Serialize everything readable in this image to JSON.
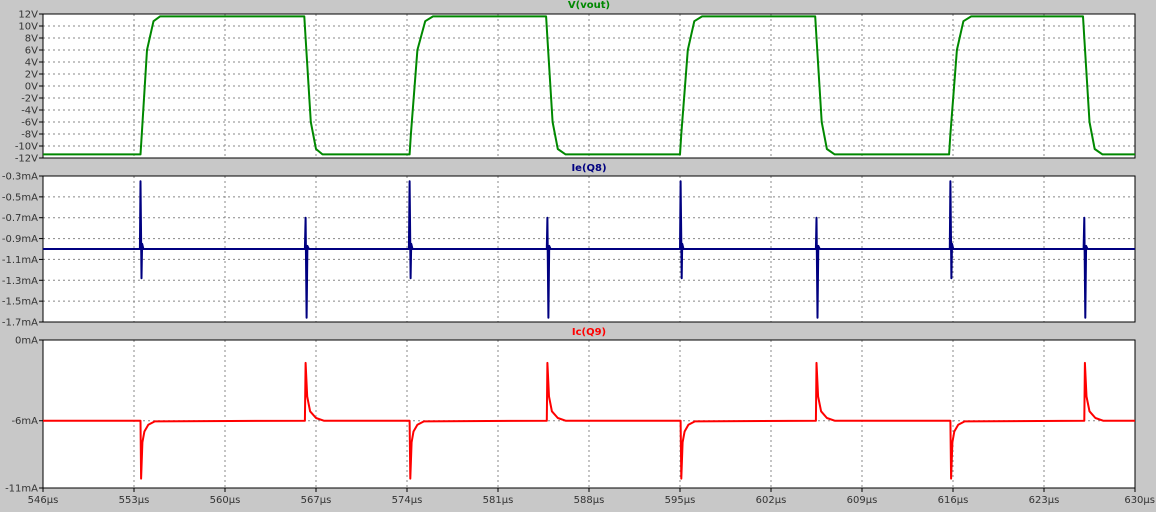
{
  "window": {
    "background": "#C8C8C8",
    "plot_background": "#FFFFFF",
    "grid_color": "#888888",
    "frame_color": "#000000"
  },
  "chart_data": [
    {
      "type": "line",
      "title": "V(vout)",
      "color": "#008800",
      "x_unit": "µs",
      "xlim": [
        546,
        630
      ],
      "x_ticks": [
        546,
        553,
        560,
        567,
        574,
        581,
        588,
        595,
        602,
        609,
        616,
        623,
        630
      ],
      "x_tick_labels": [
        "546µs",
        "553µs",
        "560µs",
        "567µs",
        "574µs",
        "581µs",
        "588µs",
        "595µs",
        "602µs",
        "609µs",
        "616µs",
        "623µs",
        "630µs"
      ],
      "ylim": [
        -12,
        12
      ],
      "y_ticks": [
        12,
        10,
        8,
        6,
        4,
        2,
        0,
        -2,
        -4,
        -6,
        -8,
        -10,
        -12
      ],
      "y_tick_labels": [
        "12V",
        "10V",
        "8V",
        "6V",
        "4V",
        "2V",
        "0V",
        "-2V",
        "-4V",
        "-6V",
        "-8V",
        "-10V",
        "-12V"
      ],
      "grid": true,
      "series": [
        {
          "name": "V(vout)",
          "x": [
            546,
            553.5,
            553.6,
            554,
            554.5,
            555,
            566.1,
            566.2,
            566.6,
            567,
            567.5,
            574.2,
            574.3,
            574.8,
            575.4,
            576,
            584.7,
            584.8,
            585.2,
            585.6,
            586.2,
            595.0,
            595.1,
            595.6,
            596.1,
            596.7,
            605.4,
            605.5,
            605.9,
            606.3,
            606.9,
            615.7,
            615.8,
            616.3,
            616.8,
            617.4,
            626.0,
            626.1,
            626.5,
            626.9,
            627.5,
            630
          ],
          "y": [
            -11.4,
            -11.4,
            -8,
            6,
            10.8,
            11.6,
            11.6,
            8,
            -6,
            -10.5,
            -11.4,
            -11.4,
            -8,
            6,
            10.8,
            11.6,
            11.6,
            8,
            -6,
            -10.5,
            -11.4,
            -11.4,
            -8,
            6,
            10.8,
            11.6,
            11.6,
            8,
            -6,
            -10.5,
            -11.4,
            -11.4,
            -8,
            6,
            10.8,
            11.6,
            11.6,
            8,
            -6,
            -10.5,
            -11.4,
            -11.4
          ]
        }
      ]
    },
    {
      "type": "line",
      "title": "Ie(Q8)",
      "color": "#000080",
      "x_unit": "µs",
      "xlim": [
        546,
        630
      ],
      "x_ticks": [
        546,
        553,
        560,
        567,
        574,
        581,
        588,
        595,
        602,
        609,
        616,
        623,
        630
      ],
      "ylim": [
        -1.7,
        -0.3
      ],
      "y_ticks": [
        -0.3,
        -0.5,
        -0.7,
        -0.9,
        -1.1,
        -1.3,
        -1.5,
        -1.7
      ],
      "y_tick_labels": [
        "-0.3mA",
        "-0.5mA",
        "-0.7mA",
        "-0.9mA",
        "-1.1mA",
        "-1.3mA",
        "-1.5mA",
        "-1.7mA"
      ],
      "grid": true,
      "series": [
        {
          "name": "Ie(Q8)",
          "x": [
            546,
            553.45,
            553.5,
            553.58,
            553.62,
            553.72,
            554.0,
            566.15,
            566.2,
            566.28,
            566.34,
            566.45,
            567.0,
            574.15,
            574.2,
            574.28,
            574.32,
            574.42,
            574.7,
            584.75,
            584.8,
            584.88,
            584.94,
            585.05,
            585.6,
            595.0,
            595.05,
            595.13,
            595.17,
            595.27,
            595.55,
            605.45,
            605.5,
            605.58,
            605.64,
            605.75,
            606.3,
            615.75,
            615.8,
            615.88,
            615.92,
            616.02,
            616.3,
            626.05,
            626.1,
            626.18,
            626.24,
            626.35,
            626.9,
            630
          ],
          "y": [
            -1.0,
            -1.0,
            -0.35,
            -1.28,
            -0.95,
            -1.0,
            -1.0,
            -1.0,
            -0.7,
            -1.66,
            -0.97,
            -1.0,
            -1.0,
            -1.0,
            -0.35,
            -1.28,
            -0.95,
            -1.0,
            -1.0,
            -1.0,
            -0.7,
            -1.66,
            -0.97,
            -1.0,
            -1.0,
            -1.0,
            -0.35,
            -1.28,
            -0.95,
            -1.0,
            -1.0,
            -1.0,
            -0.7,
            -1.66,
            -0.97,
            -1.0,
            -1.0,
            -1.0,
            -0.35,
            -1.28,
            -0.95,
            -1.0,
            -1.0,
            -1.0,
            -0.7,
            -1.66,
            -0.97,
            -1.0,
            -1.0,
            -1.0
          ]
        }
      ]
    },
    {
      "type": "line",
      "title": "Ic(Q9)",
      "color": "#FF0000",
      "x_unit": "µs",
      "xlim": [
        546,
        630
      ],
      "x_ticks": [
        546,
        553,
        560,
        567,
        574,
        581,
        588,
        595,
        602,
        609,
        616,
        623,
        630
      ],
      "x_tick_labels": [
        "546µs",
        "553µs",
        "560µs",
        "567µs",
        "574µs",
        "581µs",
        "588µs",
        "595µs",
        "602µs",
        "609µs",
        "616µs",
        "623µs",
        "630µs"
      ],
      "ylim": [
        -11,
        0
      ],
      "y_ticks": [
        0,
        -6,
        -11
      ],
      "y_tick_labels": [
        "0mA",
        "-6mA",
        "-11mA"
      ],
      "grid": true,
      "series": [
        {
          "name": "Ic(Q9)",
          "x": [
            546,
            553.5,
            553.55,
            553.65,
            553.8,
            554.1,
            554.6,
            566.15,
            566.2,
            566.32,
            566.55,
            567.0,
            567.6,
            574.2,
            574.25,
            574.35,
            574.5,
            574.8,
            575.3,
            584.75,
            584.8,
            584.92,
            585.15,
            585.6,
            586.2,
            595.05,
            595.1,
            595.2,
            595.35,
            595.65,
            596.15,
            605.45,
            605.5,
            605.62,
            605.85,
            606.3,
            606.9,
            615.8,
            615.85,
            615.95,
            616.1,
            616.4,
            616.9,
            626.1,
            626.15,
            626.27,
            626.5,
            626.95,
            627.55,
            630
          ],
          "y": [
            -6.0,
            -6.0,
            -10.3,
            -7.6,
            -6.8,
            -6.3,
            -6.05,
            -6.0,
            -1.7,
            -4.2,
            -5.3,
            -5.8,
            -6.0,
            -6.0,
            -10.3,
            -7.6,
            -6.8,
            -6.3,
            -6.05,
            -6.0,
            -1.7,
            -4.2,
            -5.3,
            -5.8,
            -6.0,
            -6.0,
            -10.3,
            -7.6,
            -6.8,
            -6.3,
            -6.05,
            -6.0,
            -1.7,
            -4.2,
            -5.3,
            -5.8,
            -6.0,
            -6.0,
            -10.3,
            -7.6,
            -6.8,
            -6.3,
            -6.05,
            -6.0,
            -1.7,
            -4.2,
            -5.3,
            -5.8,
            -6.0,
            -6.0
          ]
        }
      ]
    }
  ]
}
